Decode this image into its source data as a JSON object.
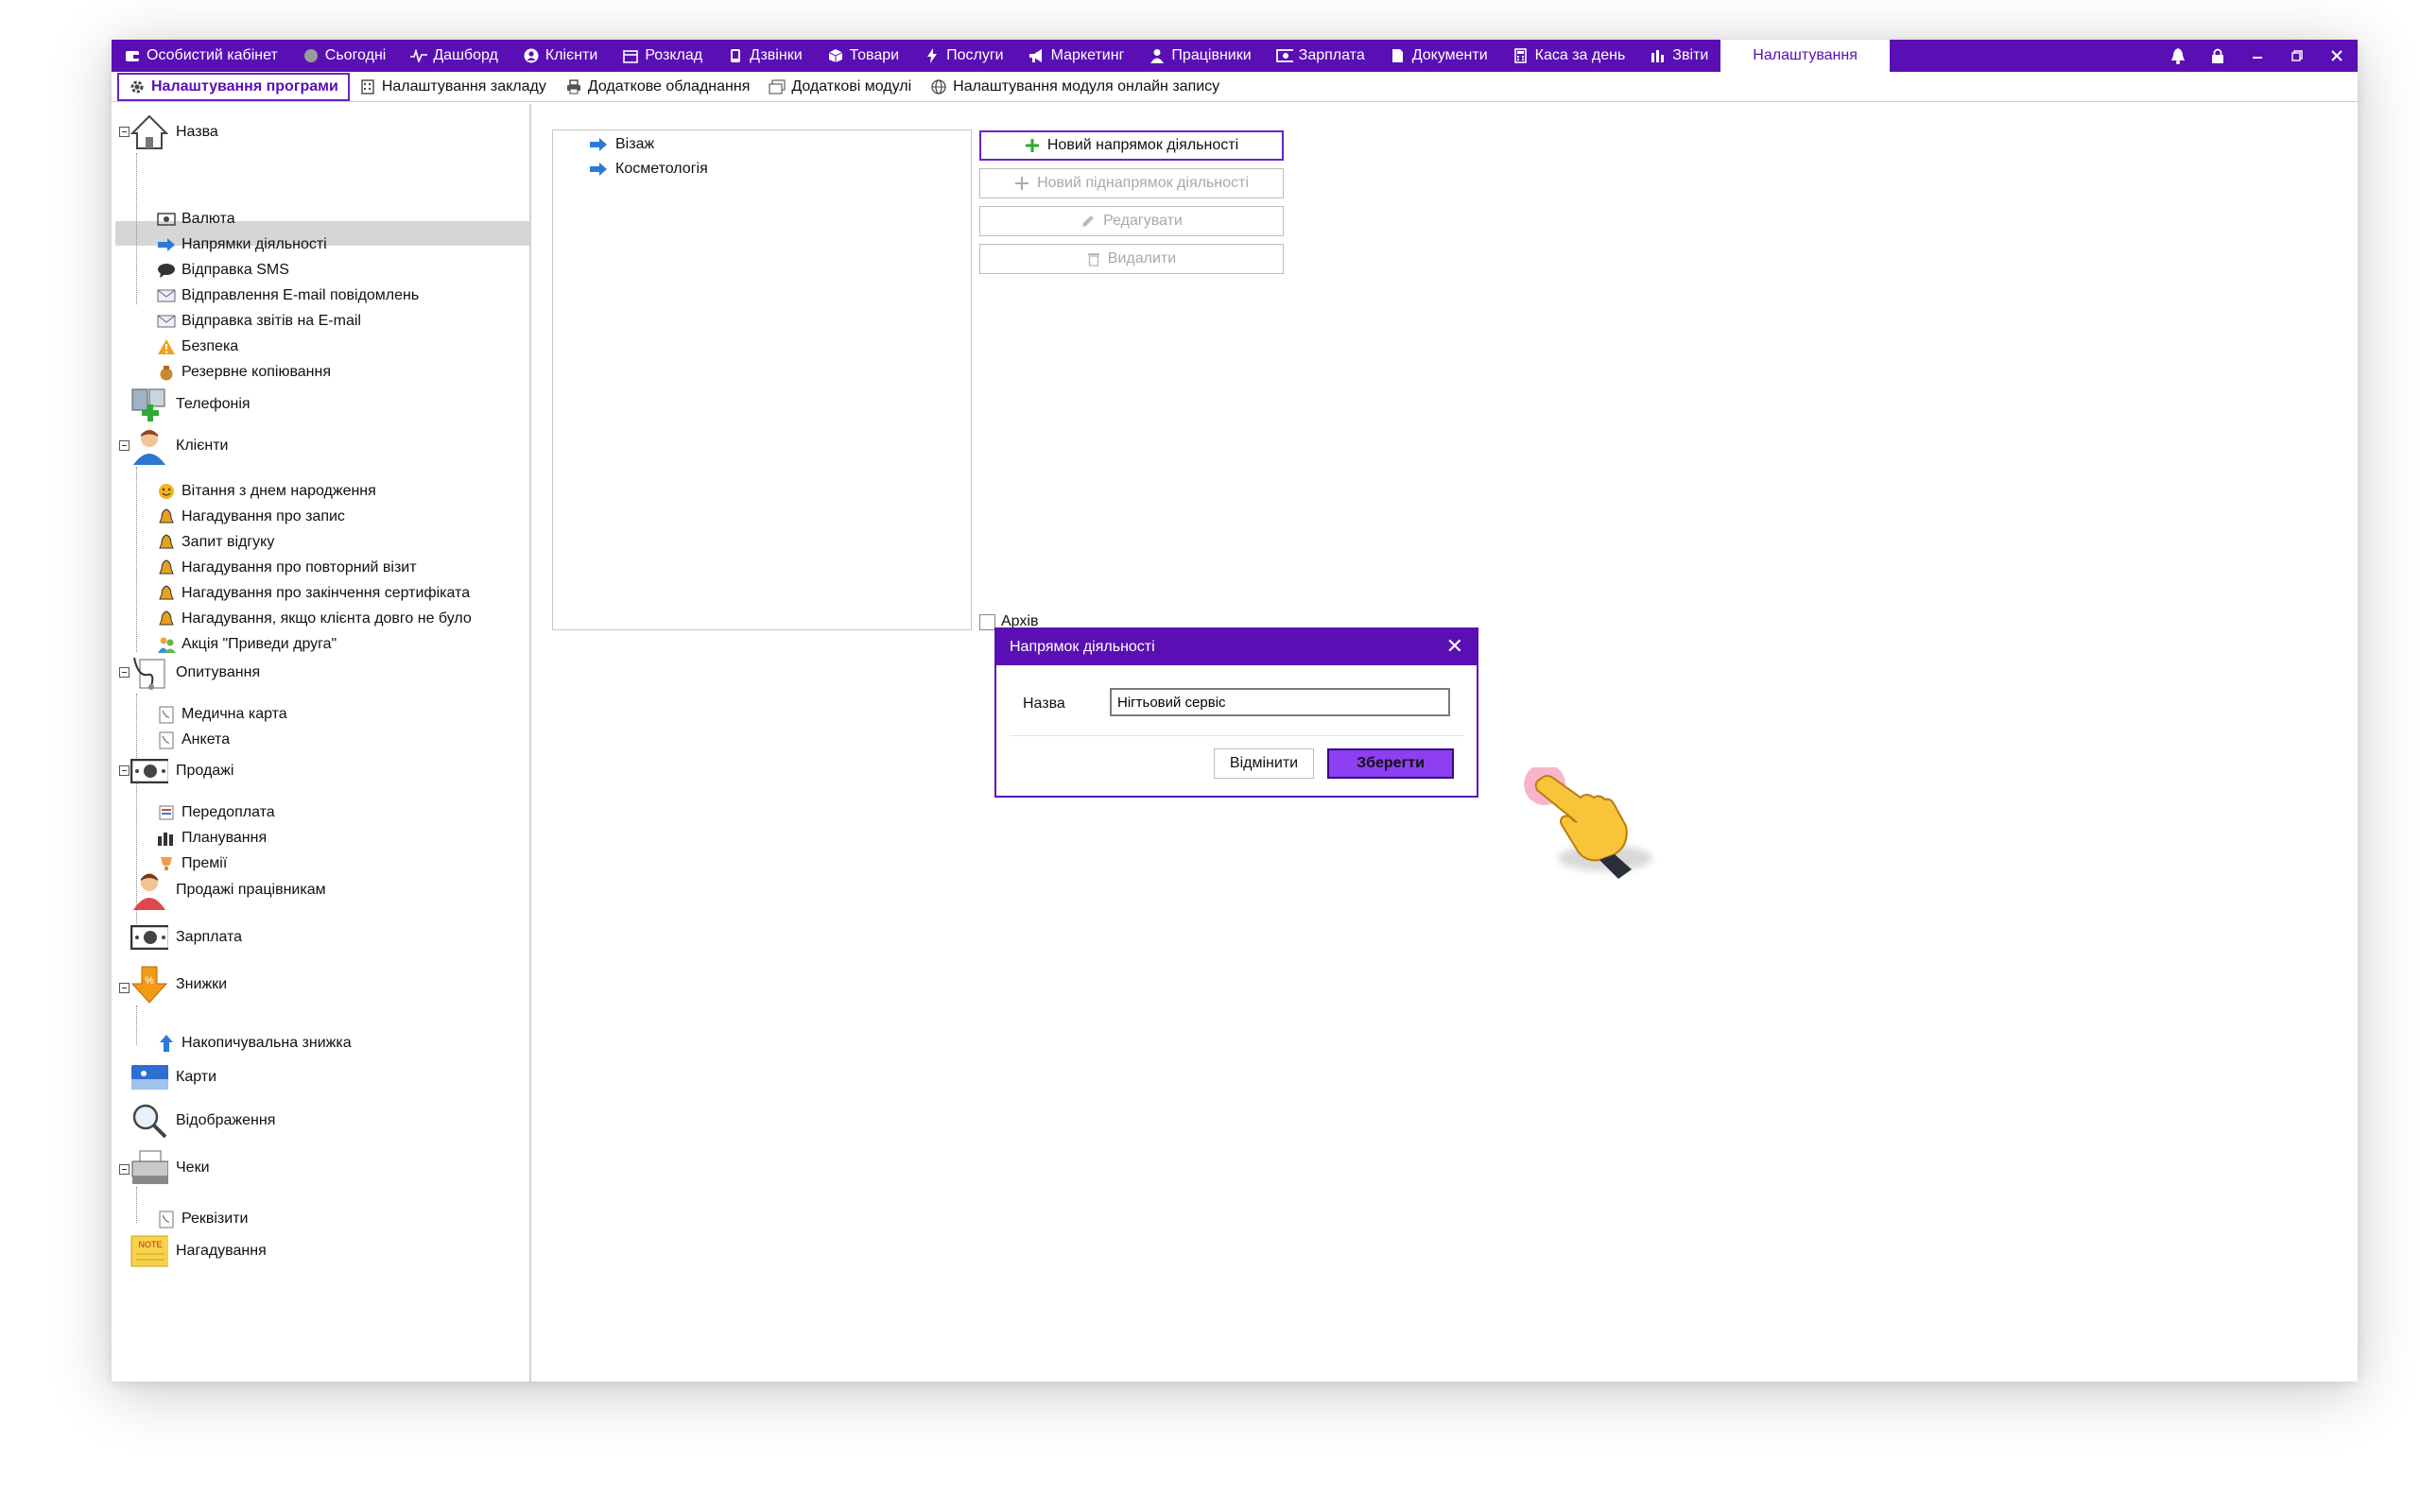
{
  "topnav": {
    "items": [
      {
        "label": "Особистий кабінет",
        "icon": "wallet-icon"
      },
      {
        "label": "Сьогодні",
        "icon": "globe-icon"
      },
      {
        "label": "Дашборд",
        "icon": "pulse-icon"
      },
      {
        "label": "Клієнти",
        "icon": "user-circle-icon"
      },
      {
        "label": "Розклад",
        "icon": "calendar-icon"
      },
      {
        "label": "Дзвінки",
        "icon": "phone-icon"
      },
      {
        "label": "Товари",
        "icon": "box-icon"
      },
      {
        "label": "Послуги",
        "icon": "lightning-icon"
      },
      {
        "label": "Маркетинг",
        "icon": "megaphone-icon"
      },
      {
        "label": "Працівники",
        "icon": "person-icon"
      },
      {
        "label": "Зарплата",
        "icon": "money-icon"
      },
      {
        "label": "Документи",
        "icon": "document-icon"
      },
      {
        "label": "Каса за день",
        "icon": "calculator-icon"
      },
      {
        "label": "Звіти",
        "icon": "bar-chart-icon"
      }
    ],
    "active": "Налаштування"
  },
  "subtabs": [
    {
      "label": "Налаштування програми",
      "icon": "gear-icon",
      "active": true
    },
    {
      "label": "Налаштування закладу",
      "icon": "building-icon"
    },
    {
      "label": "Додаткове обладнання",
      "icon": "printer-icon"
    },
    {
      "label": "Додаткові модулі",
      "icon": "modules-icon"
    },
    {
      "label": "Налаштування модуля онлайн запису",
      "icon": "globe-icon"
    }
  ],
  "tree": {
    "name": "Назва",
    "name_children": [
      "Валюта",
      "Напрямки діяльності",
      "Відправка SMS",
      "Відправлення E-mail повідомлень",
      "Відправка звітів на E-mail",
      "Безпека",
      "Резервне копіювання"
    ],
    "telephony": "Телефонія",
    "clients": "Клієнти",
    "clients_children": [
      "Вітання з днем народження",
      "Нагадування про запис",
      "Запит відгуку",
      "Нагадування про повторний візит",
      "Нагадування про закінчення сертифіката",
      "Нагадування, якщо клієнта довго не було",
      "Акція \"Приведи друга\""
    ],
    "surveys": "Опитування",
    "surveys_children": [
      "Медична карта",
      "Анкета"
    ],
    "sales": "Продажі",
    "sales_children": [
      "Передоплата",
      "Планування",
      "Премії"
    ],
    "employee_sales": "Продажі працівникам",
    "salary": "Зарплата",
    "discounts": "Знижки",
    "discounts_children": [
      "Накопичувальна знижка"
    ],
    "cards": "Карти",
    "display": "Відображення",
    "receipts": "Чеки",
    "receipts_children": [
      "Реквізити"
    ],
    "reminders": "Нагадування",
    "note_label": "NOTE"
  },
  "directions": [
    "Візаж",
    "Косметологія"
  ],
  "buttons": {
    "new_direction": "Новий напрямок діяльності",
    "new_subdirection": "Новий піднапрямок діяльності",
    "edit": "Редагувати",
    "delete": "Видалити"
  },
  "archive_label": "Архів",
  "dialog": {
    "title": "Напрямок діяльності",
    "name_label": "Назва",
    "name_value": "Нігтьовий сервіс",
    "cancel": "Відмінити",
    "save": "Зберегти"
  },
  "colors": {
    "brand": "#5a0fb4",
    "save_button": "#8e3ff2",
    "selection": "#d6d6d6"
  }
}
